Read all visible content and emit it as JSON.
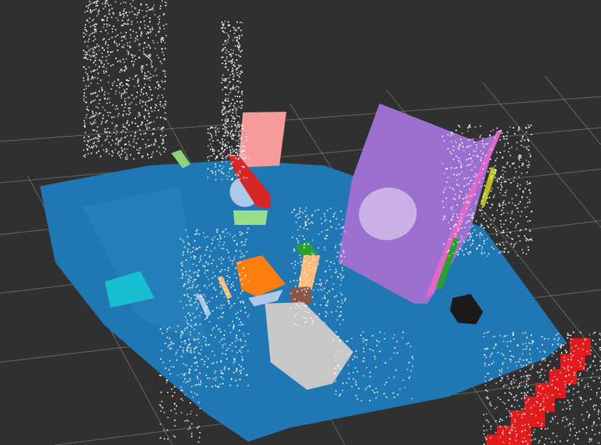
{
  "scene": {
    "background_color": "#303030",
    "grid_color": "#a0a0a0",
    "objects": [
      {
        "name": "table-plane",
        "color": "#1f78b4"
      },
      {
        "name": "vertical-board",
        "color": "#9b6fd0"
      },
      {
        "name": "board-edge",
        "color": "#e067c8"
      },
      {
        "name": "board-circle",
        "color": "#c9b0e6"
      },
      {
        "name": "pink-box",
        "color": "#f49a9a"
      },
      {
        "name": "red-object",
        "color": "#d62728"
      },
      {
        "name": "light-blue-blob",
        "color": "#aec7e8"
      },
      {
        "name": "light-green-box",
        "color": "#98df8a"
      },
      {
        "name": "small-green-box",
        "color": "#8fd17a"
      },
      {
        "name": "teal-box",
        "color": "#17becf"
      },
      {
        "name": "orange-box",
        "color": "#ff7f0e"
      },
      {
        "name": "peach-box",
        "color": "#ffbb78"
      },
      {
        "name": "green-box",
        "color": "#2ca02c"
      },
      {
        "name": "brown-box",
        "color": "#8c564b"
      },
      {
        "name": "gray-box",
        "color": "#c7c7c7"
      },
      {
        "name": "yellow-stick",
        "color": "#bcbd22"
      },
      {
        "name": "green-stick",
        "color": "#2ca02c"
      },
      {
        "name": "black-object",
        "color": "#1a1a1a"
      },
      {
        "name": "red-stair-cubes",
        "color": "#e31a1c"
      },
      {
        "name": "white-point-cloud",
        "color": "#ffffff"
      }
    ]
  }
}
